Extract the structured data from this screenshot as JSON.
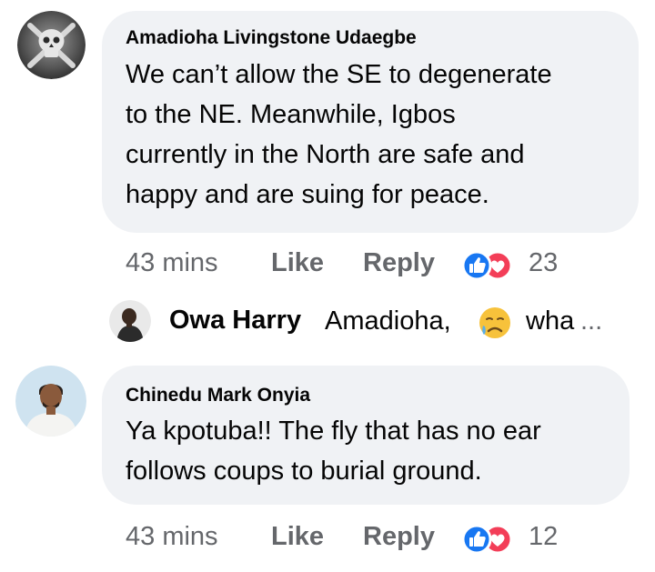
{
  "comments": [
    {
      "author": "Amadioha Livingstone Udaegbe",
      "text": "We can’t allow the SE to degenerate\nto the NE. Meanwhile, Igbos\ncurrently in the North are safe and\nhappy and are suing for peace.",
      "time": "43 mins",
      "like_label": "Like",
      "reply_label": "Reply",
      "reaction_count": "23",
      "reaction_icons": [
        "like-icon",
        "love-icon"
      ],
      "avatar_icon": "skull-crossbones-avatar"
    },
    {
      "author": "Chinedu Mark Onyia",
      "text": "Ya kpotuba!! The fly that has no ear\nfollows coups  to burial ground.",
      "time": "43 mins",
      "like_label": "Like",
      "reply_label": "Reply",
      "reaction_count": "12",
      "reaction_icons": [
        "like-icon",
        "love-icon"
      ],
      "avatar_icon": "person-avatar"
    }
  ],
  "reply_preview": {
    "author": "Owa Harry",
    "text": "Amadioha,",
    "emoji": "sad-relieved-face-emoji",
    "trailing_text": "wha",
    "ellipsis": "..."
  },
  "colors": {
    "bubble": "#f0f2f5",
    "meta": "#65676b",
    "like_blue": "#1877f2",
    "love_red": "#f33e58"
  }
}
